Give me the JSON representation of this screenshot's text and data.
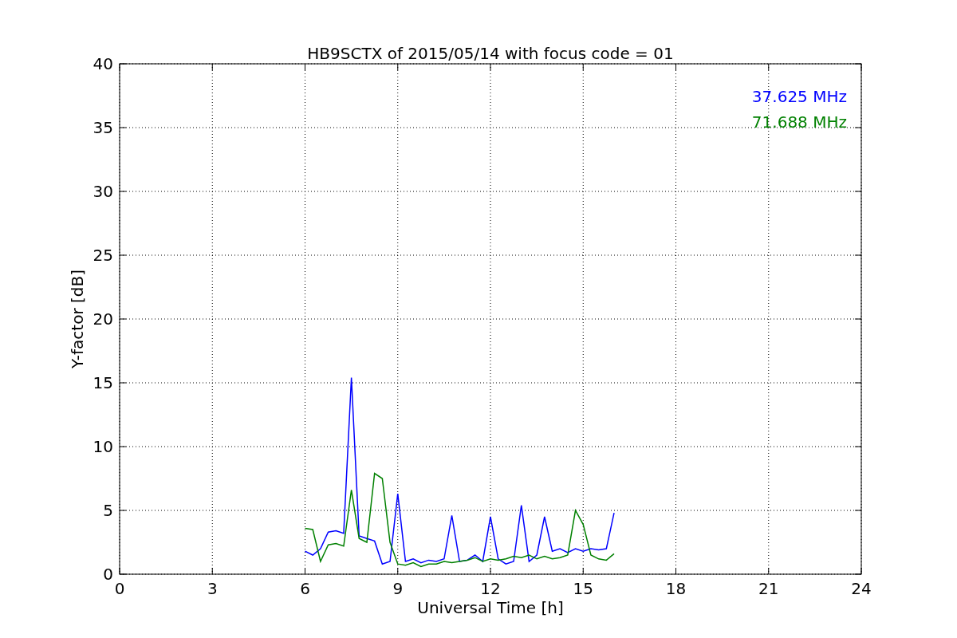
{
  "chart_data": {
    "type": "line",
    "title": "HB9SCTX of 2015/05/14 with focus code = 01",
    "xlabel": "Universal Time [h]",
    "ylabel": "Y-factor [dB]",
    "x": [
      6,
      6.25,
      6.5,
      6.75,
      7,
      7.25,
      7.5,
      7.75,
      8,
      8.25,
      8.5,
      8.75,
      9,
      9.25,
      9.5,
      9.75,
      10,
      10.25,
      10.5,
      10.75,
      11,
      11.25,
      11.5,
      11.75,
      12,
      12.25,
      12.5,
      12.75,
      13,
      13.25,
      13.5,
      13.75,
      14,
      14.25,
      14.5,
      14.75,
      15,
      15.25,
      15.5,
      15.75,
      16
    ],
    "series": [
      {
        "name": "37.625 MHz",
        "color": "#0000ff",
        "values": [
          1.8,
          1.5,
          2,
          3.3,
          3.4,
          3.2,
          15.4,
          3,
          2.8,
          2.6,
          0.8,
          1,
          6.3,
          1,
          1.2,
          0.9,
          1.1,
          1,
          1.2,
          4.6,
          1,
          1.1,
          1.5,
          1,
          4.5,
          1.2,
          0.8,
          1,
          5.4,
          1,
          1.5,
          4.5,
          1.8,
          2,
          1.7,
          2,
          1.8,
          2,
          1.9,
          2,
          4.8
        ]
      },
      {
        "name": "71.688 MHz",
        "color": "#008000",
        "values": [
          3.6,
          3.5,
          1,
          2.3,
          2.4,
          2.2,
          6.6,
          2.8,
          2.5,
          7.9,
          7.5,
          2.5,
          0.8,
          0.7,
          0.9,
          0.6,
          0.8,
          0.8,
          1,
          0.9,
          1,
          1.1,
          1.3,
          1,
          1.2,
          1.1,
          1.2,
          1.4,
          1.3,
          1.5,
          1.2,
          1.4,
          1.2,
          1.3,
          1.5,
          5,
          3.9,
          1.5,
          1.2,
          1.1,
          1.6
        ]
      }
    ],
    "xlim": [
      0,
      24
    ],
    "ylim": [
      0,
      40
    ],
    "xticks": [
      0,
      3,
      6,
      9,
      12,
      15,
      18,
      21,
      24
    ],
    "yticks": [
      0,
      5,
      10,
      15,
      20,
      25,
      30,
      35,
      40
    ],
    "grid": true
  }
}
